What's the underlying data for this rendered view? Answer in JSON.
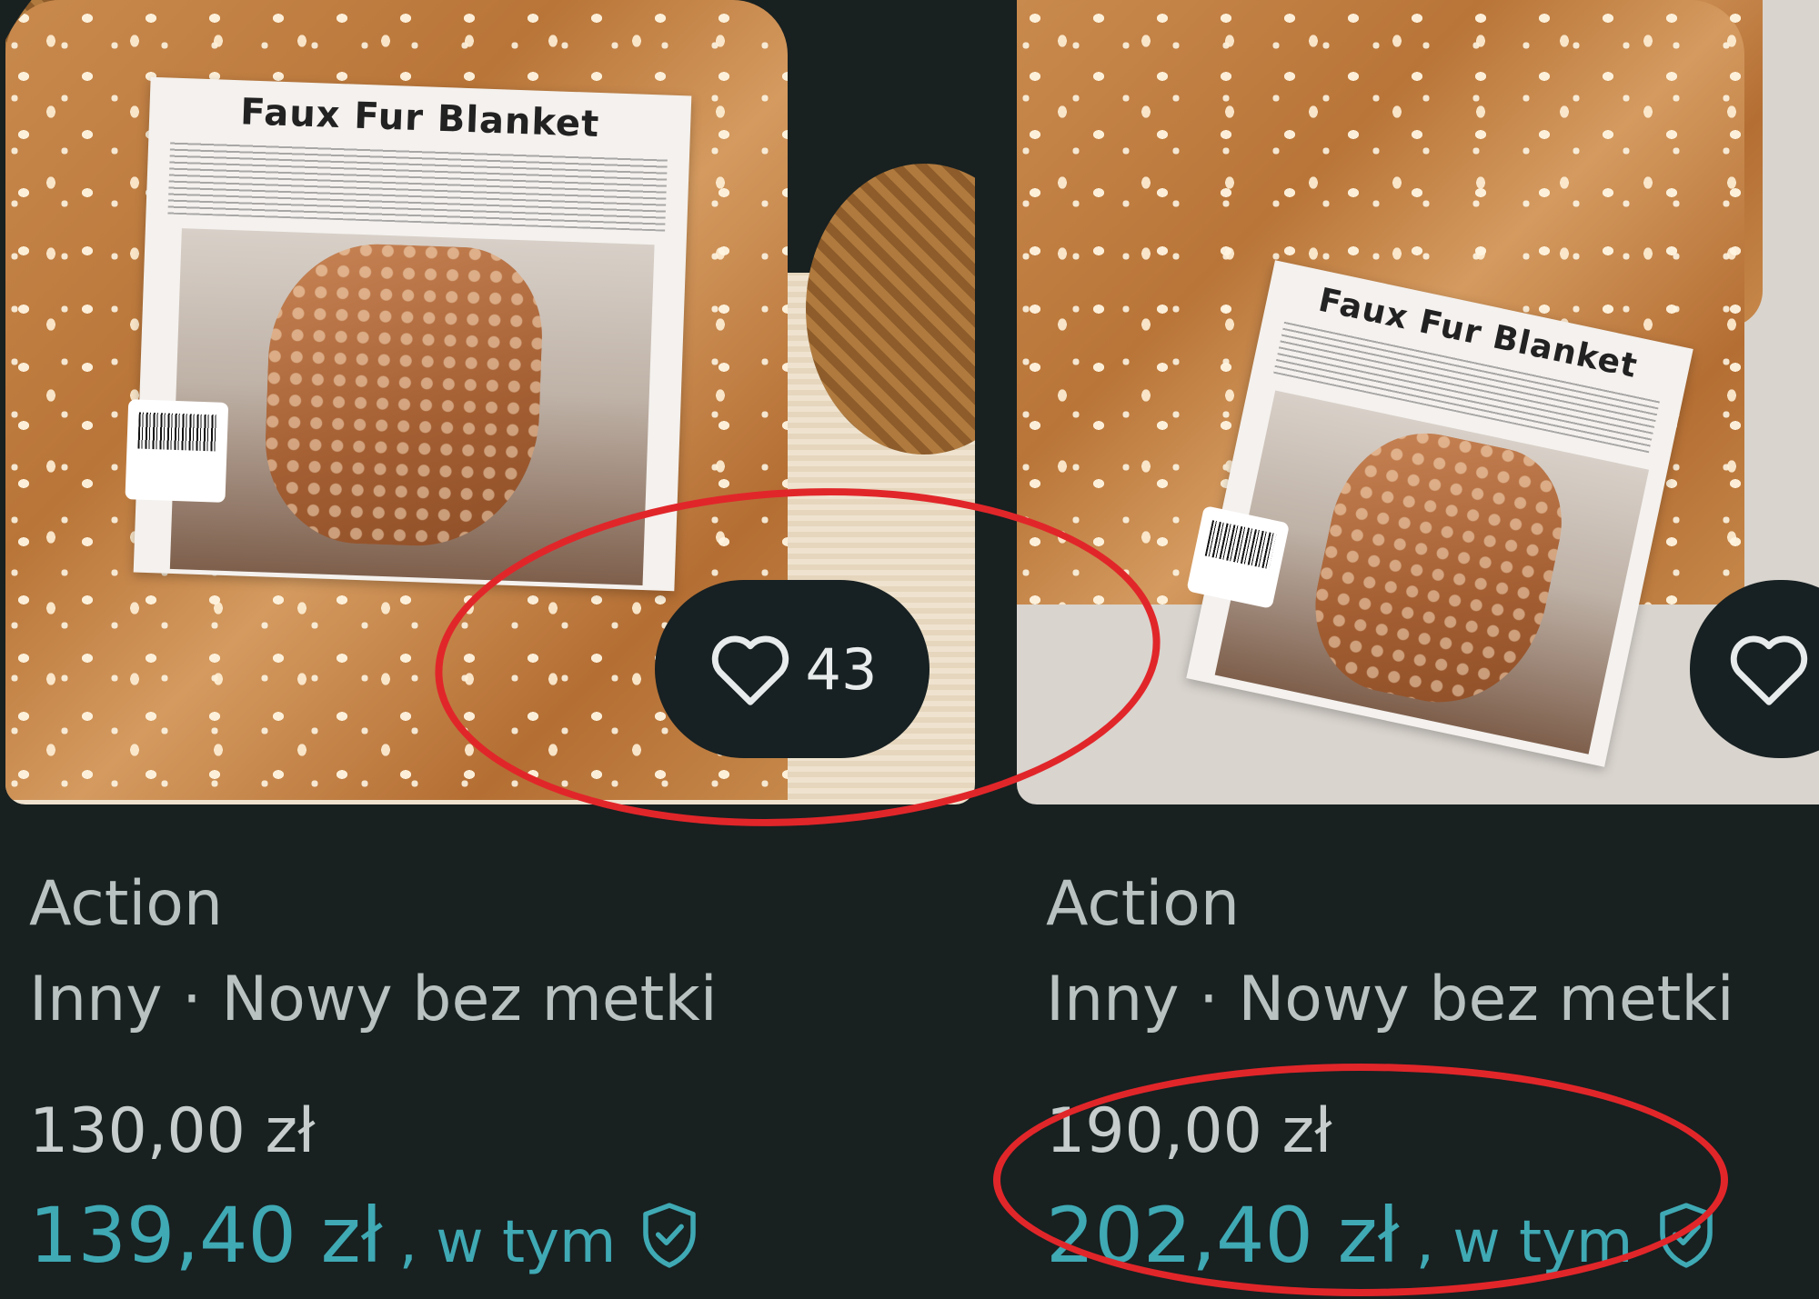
{
  "listings": [
    {
      "package_title": "Faux Fur Blanket",
      "likes": "43",
      "brand": "Action",
      "meta": "Inny · Nowy bez metki",
      "price": "130,00 zł",
      "total_price": "139,40 zł",
      "included_suffix": ", w tym"
    },
    {
      "package_title": "Faux Fur Blanket",
      "likes": "",
      "brand": "Action",
      "meta": "Inny · Nowy bez metki",
      "price": "190,00 zł",
      "total_price": "202,40 zł",
      "included_suffix": ", w tym"
    }
  ],
  "colors": {
    "background": "#182020",
    "accent_teal": "#3fa9b4",
    "annotation_red": "#e1262a",
    "text_secondary": "#b9c1c1"
  },
  "icons": {
    "favorite": "heart-outline-icon",
    "buyer_protection": "shield-check-icon"
  }
}
